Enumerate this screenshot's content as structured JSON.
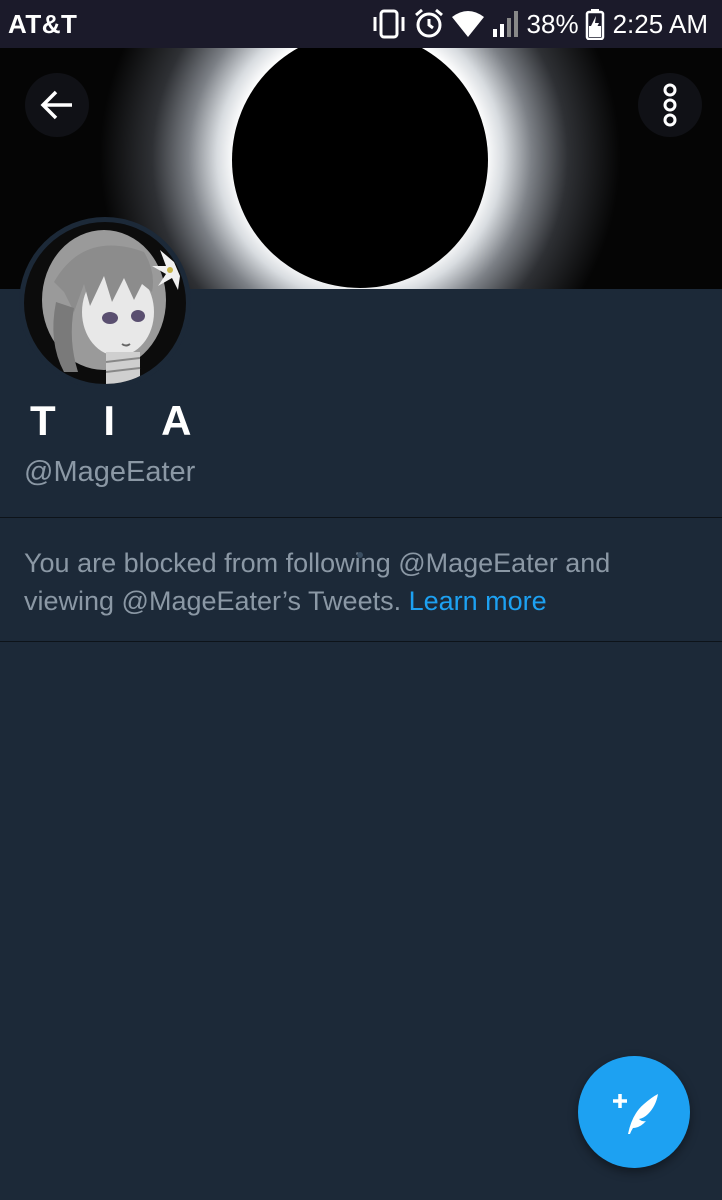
{
  "status_bar": {
    "carrier": "AT&T",
    "battery_percent": "38%",
    "time": "2:25 AM",
    "icons": [
      "vibrate-icon",
      "alarm-icon",
      "wifi-icon",
      "signal-icon",
      "battery-charging-icon"
    ]
  },
  "header": {
    "back_icon": "arrow-left-icon",
    "more_icon": "more-vertical-icon",
    "banner": "solar-eclipse-image"
  },
  "profile": {
    "display_name": "T I A",
    "handle": "@MageEater",
    "avatar": "anime-girl-avatar"
  },
  "blocked_notice": {
    "message": "You are blocked from following @MageEater and viewing @MageEater’s Tweets.",
    "link_label": "Learn more"
  },
  "fab": {
    "icon": "compose-tweet-icon"
  },
  "colors": {
    "background": "#1c2938",
    "status_bar": "#1b1a2a",
    "accent": "#1da1f2",
    "secondary_text": "#8b98a5",
    "primary_text": "#ffffff"
  }
}
